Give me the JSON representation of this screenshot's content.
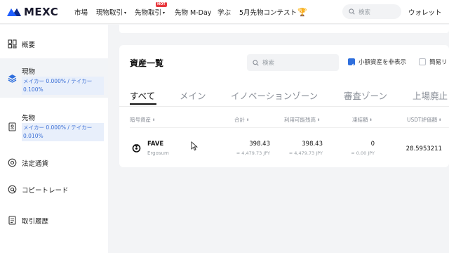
{
  "brand": {
    "logo_text": "MEXC"
  },
  "nav": {
    "items": [
      {
        "label": "市場"
      },
      {
        "label": "現物取引",
        "caret": "▾"
      },
      {
        "label": "先物取引",
        "caret": "▾",
        "badge": "HOT"
      },
      {
        "label": "先物 M-Day"
      },
      {
        "label": "学ぶ"
      },
      {
        "label": "5月先物コンテスト",
        "icon": "trophy-icon"
      }
    ],
    "search_placeholder": "検索",
    "wallet_label": "ウォレット"
  },
  "sidebar": {
    "items": [
      {
        "label": "概要",
        "icon": "overview-icon"
      },
      {
        "label": "現物",
        "icon": "layers-icon",
        "fee": "メイカー 0.000% / テイカー 0.100%",
        "active": true
      },
      {
        "label": "先物",
        "icon": "futures-doc-icon",
        "fee": "メイカー 0.000% / テイカー 0.010%"
      },
      {
        "label": "法定通貨",
        "icon": "fiat-icon"
      },
      {
        "label": "コピートレード",
        "icon": "copy-trade-icon"
      },
      {
        "label": "取引履歴",
        "icon": "history-icon"
      }
    ]
  },
  "assets": {
    "title": "資産一覧",
    "search_placeholder": "検索",
    "hide_small_label": "小額資産を非表示",
    "hide_small_checked": true,
    "simple_label": "簡易リ",
    "simple_checked": false,
    "tabs": [
      "すべて",
      "メイン",
      "イノベーションゾーン",
      "審査ゾーン",
      "上場廃止"
    ],
    "active_tab": 0,
    "columns": [
      "暗号資産",
      "合計",
      "利用可能残高",
      "凍結額",
      "USDT評価額"
    ],
    "sort_glyph": "⬍",
    "rows": [
      {
        "symbol": "FAVE",
        "name": "Ergosum",
        "total": "398.43",
        "total_jpy": "≈ 4,479.73 JPY",
        "available": "398.43",
        "available_jpy": "≈ 4,479.73 JPY",
        "frozen": "0",
        "frozen_jpy": "≈ 0.00 JPY",
        "usdt_value": "28.5953211"
      }
    ]
  },
  "colors": {
    "accent": "#2f6fdd",
    "fee_text": "#3b6fd6",
    "hot": "#e8383d",
    "logo_mark": "#1e5eff"
  }
}
